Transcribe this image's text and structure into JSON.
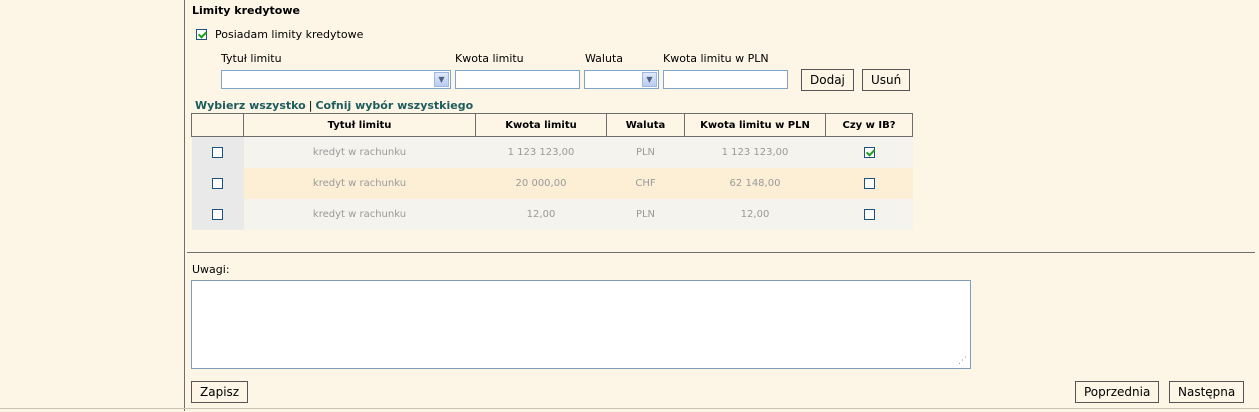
{
  "section": {
    "title": "Limity kredytowe",
    "has_limits_label": "Posiadam limity kredytowe",
    "has_limits_checked": true
  },
  "form": {
    "title_label": "Tytuł limitu",
    "amount_label": "Kwota limitu",
    "currency_label": "Waluta",
    "pln_label": "Kwota limitu w PLN",
    "title_value": "",
    "amount_value": "",
    "currency_value": "",
    "pln_value": "",
    "add_label": "Dodaj",
    "remove_label": "Usuń"
  },
  "selection": {
    "select_all": "Wybierz wszystko",
    "separator": "|",
    "deselect_all": "Cofnij wybór wszystkiego"
  },
  "table": {
    "headers": [
      "",
      "Tytuł limitu",
      "Kwota limitu",
      "Waluta",
      "Kwota limitu w PLN",
      "Czy w IB?"
    ],
    "rows": [
      {
        "selected": false,
        "title": "kredyt w rachunku",
        "amount": "1 123 123,00",
        "currency": "PLN",
        "pln": "1 123 123,00",
        "in_ib": true
      },
      {
        "selected": false,
        "title": "kredyt w rachunku",
        "amount": "20 000,00",
        "currency": "CHF",
        "pln": "62 148,00",
        "in_ib": false
      },
      {
        "selected": false,
        "title": "kredyt w rachunku",
        "amount": "12,00",
        "currency": "PLN",
        "pln": "12,00",
        "in_ib": false
      }
    ]
  },
  "notes": {
    "label": "Uwagi:",
    "value": ""
  },
  "footer": {
    "save_label": "Zapisz",
    "prev_label": "Poprzednia",
    "next_label": "Następna"
  },
  "icons": {
    "dropdown": "chevron-down-icon",
    "check": "checkmark-icon",
    "resize": "resize-grip-icon"
  }
}
